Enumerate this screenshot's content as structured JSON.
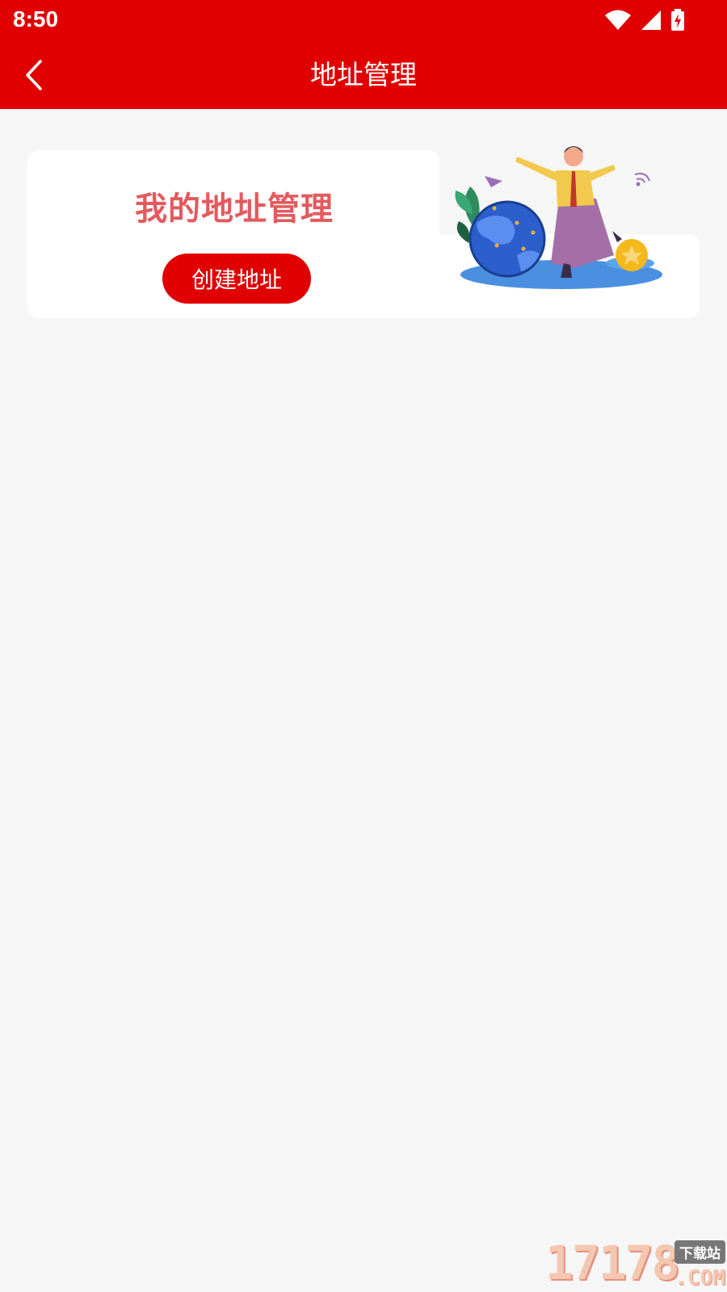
{
  "status_bar": {
    "time": "8:50",
    "icons": [
      "wifi-icon",
      "cellular-signal-icon",
      "battery-charging-icon"
    ]
  },
  "nav": {
    "back_icon": "chevron-left-icon",
    "title": "地址管理"
  },
  "card": {
    "title": "我的地址管理",
    "create_button_label": "创建地址",
    "illustration": "woman-with-globe-illustration"
  },
  "watermark": {
    "number": "17178",
    "badge": "下载站",
    "domain": ".COM"
  },
  "colors": {
    "header_bg": "#e00000",
    "page_bg": "#f6f6f6",
    "card_title": "#e35a5e",
    "button_bg": "#e00000"
  }
}
